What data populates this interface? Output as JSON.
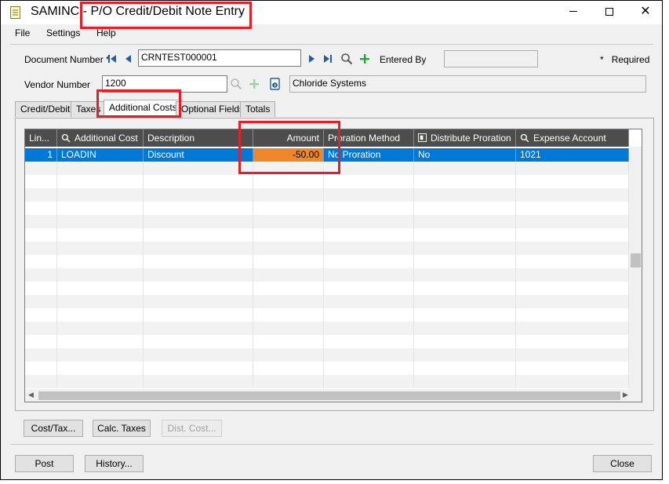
{
  "window": {
    "title": "SAMINC - P/O Credit/Debit Note Entry",
    "controls": {
      "minimize": "minimize",
      "maximize": "maximize",
      "close": "✕"
    }
  },
  "menu": {
    "file": "File",
    "settings": "Settings",
    "help": "Help"
  },
  "header": {
    "document_number_label": "Document Number",
    "document_number_required_mark": "*",
    "document_number_value": "CRNTEST000001",
    "entered_by_label": "Entered By",
    "entered_by_value": "",
    "required_mark": "*",
    "required_label": "Required",
    "vendor_number_label": "Vendor Number",
    "vendor_number_value": "1200",
    "vendor_name_value": "Chloride Systems"
  },
  "tabs": [
    {
      "label": "Credit/Debit"
    },
    {
      "label": "Taxes"
    },
    {
      "label": "Additional Costs"
    },
    {
      "label": "Optional Fields"
    },
    {
      "label": "Totals"
    }
  ],
  "grid": {
    "columns": [
      "Lin...",
      "Additional Cost",
      "Description",
      "Amount",
      "Proration Method",
      "Distribute Proration",
      "Expense Account"
    ],
    "rows": [
      {
        "line": "1",
        "additional_cost": "LOADIN",
        "description": "Discount",
        "amount": "-50.00",
        "proration_method": "No Proration",
        "distribute_proration": "No",
        "expense_account": "1021"
      }
    ]
  },
  "buttons": {
    "cost_tax": "Cost/Tax...",
    "calc_taxes": "Calc. Taxes",
    "dist_cost": "Dist. Cost...",
    "post": "Post",
    "history": "History...",
    "close": "Close"
  },
  "colors": {
    "selected_row": "#0078d7",
    "amount_highlight": "#f0862a",
    "annotation_red": "#e0202a",
    "add_icon_green": "#2e9e3e",
    "nav_blue": "#1f5fa8"
  }
}
